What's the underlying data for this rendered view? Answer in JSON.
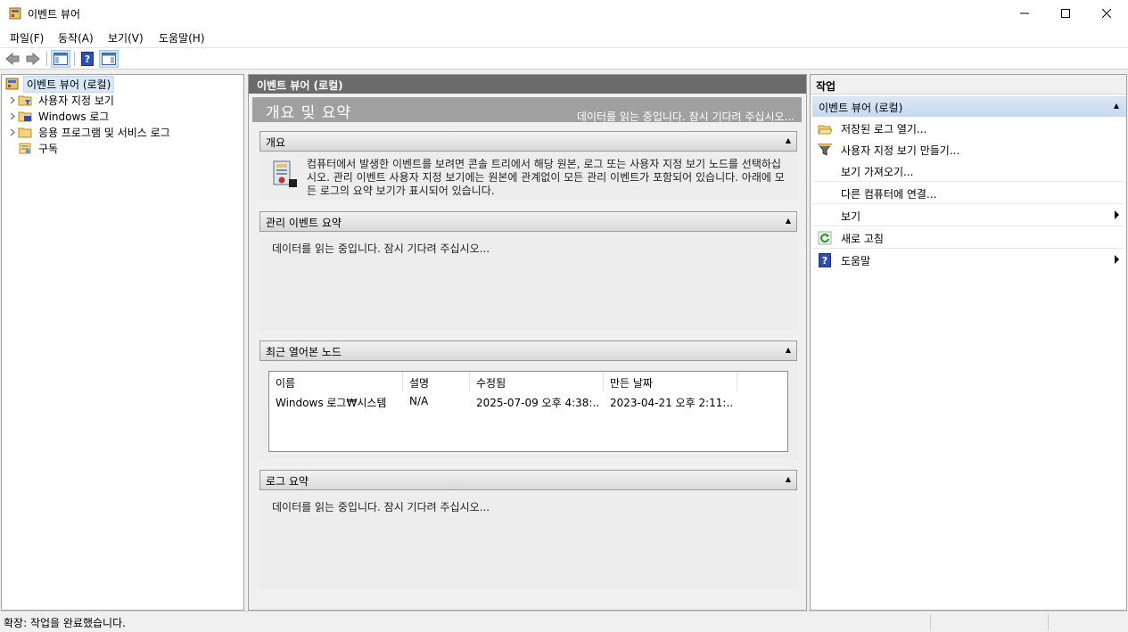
{
  "window": {
    "title": "이벤트 뷰어"
  },
  "menu": {
    "file": "파일(F)",
    "action": "동작(A)",
    "view": "보기(V)",
    "help": "도움말(H)"
  },
  "tree": {
    "root": "이벤트 뷰어 (로컬)",
    "items": [
      {
        "label": "사용자 지정 보기",
        "icon": "folder-filter-icon",
        "expandable": true
      },
      {
        "label": "Windows 로그",
        "icon": "folder-log-icon",
        "expandable": true
      },
      {
        "label": "응용 프로그램 및 서비스 로그",
        "icon": "folder-icon",
        "expandable": true
      },
      {
        "label": "구독",
        "icon": "subscription-icon",
        "expandable": false
      }
    ]
  },
  "center": {
    "header": "이벤트 뷰어 (로컬)",
    "overview_title": "개요 및 요약",
    "overview_loading": "데이터를 읽는 중입니다. 잠시 기다려 주십시오...",
    "sections": {
      "overview": {
        "title": "개요",
        "text": "컴퓨터에서 발생한 이벤트를 보려면 콘솔 트리에서 해당 원본, 로그 또는 사용자 지정 보기 노드를 선택하십시오. 관리 이벤트 사용자 지정 보기에는 원본에 관계없이 모든 관리 이벤트가 포함되어 있습니다. 아래에 모든 로그의 요약 보기가 표시되어 있습니다."
      },
      "admin_summary": {
        "title": "관리 이벤트 요약",
        "text": "데이터를 읽는 중입니다. 잠시 기다려 주십시오..."
      },
      "recent_nodes": {
        "title": "최근 열어본 노드",
        "columns": [
          "이름",
          "설명",
          "수정됨",
          "만든 날짜"
        ],
        "rows": [
          [
            "Windows 로그₩시스템",
            "N/A",
            "2025-07-09 오후 4:38:...",
            "2023-04-21 오후 2:11:..."
          ]
        ]
      },
      "log_summary": {
        "title": "로그 요약",
        "text": "데이터를 읽는 중입니다. 잠시 기다려 주십시오..."
      }
    }
  },
  "actions": {
    "header": "작업",
    "group": "이벤트 뷰어 (로컬)",
    "items": [
      {
        "label": "저장된 로그 열기...",
        "icon": "open-folder-icon",
        "submenu": false
      },
      {
        "label": "사용자 지정 보기 만들기...",
        "icon": "filter-icon",
        "submenu": false
      },
      {
        "label": "보기 가져오기...",
        "icon": "",
        "submenu": false
      },
      {
        "label": "다른 컴퓨터에 연결...",
        "icon": "",
        "submenu": false
      },
      {
        "label": "보기",
        "icon": "",
        "submenu": true
      },
      {
        "label": "새로 고침",
        "icon": "refresh-icon",
        "submenu": false
      },
      {
        "label": "도움말",
        "icon": "help-icon",
        "submenu": true
      }
    ]
  },
  "status": {
    "text": "확장:  작업을 완료했습니다."
  }
}
